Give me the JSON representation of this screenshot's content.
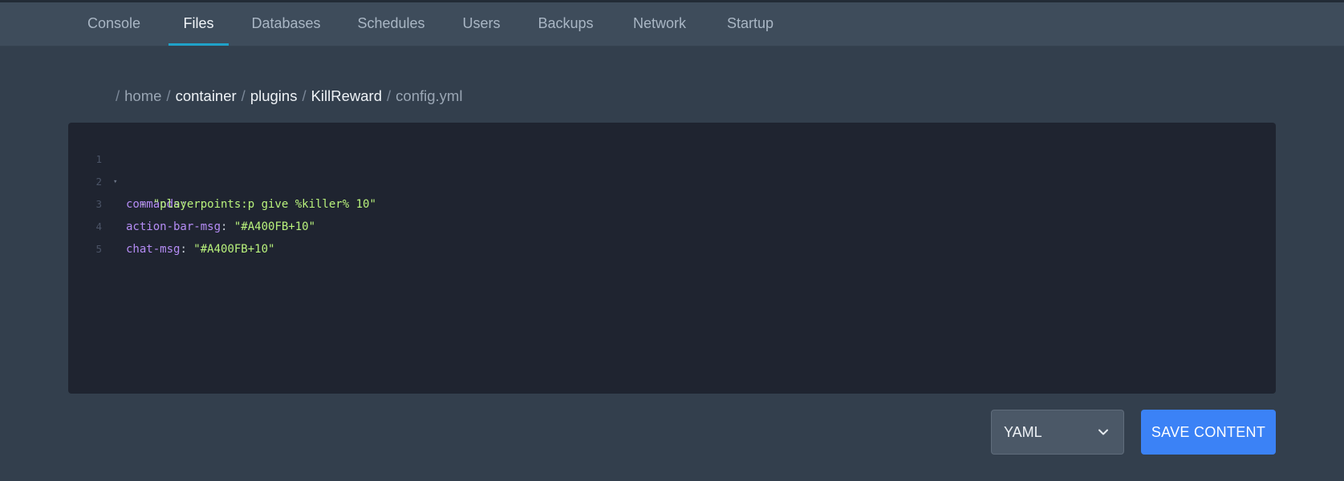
{
  "nav": {
    "tabs": [
      {
        "label": "Console"
      },
      {
        "label": "Files"
      },
      {
        "label": "Databases"
      },
      {
        "label": "Schedules"
      },
      {
        "label": "Users"
      },
      {
        "label": "Backups"
      },
      {
        "label": "Network"
      },
      {
        "label": "Startup"
      }
    ],
    "active_tab": "Files"
  },
  "breadcrumb": {
    "separator": "/",
    "items": [
      "home",
      "container",
      "plugins",
      "KillReward",
      "config.yml"
    ]
  },
  "editor": {
    "lines": [
      {
        "number": "1",
        "key": "commands",
        "colon": ":",
        "value": ""
      },
      {
        "number": "2",
        "dash": "  - ",
        "value": "\"playerpoints:p give %killer% 10\""
      },
      {
        "number": "3",
        "key": "action-bar-msg",
        "colon": ": ",
        "value": "\"#A400FB+10\""
      },
      {
        "number": "4",
        "key": "chat-msg",
        "colon": ": ",
        "value": "\"#A400FB+10\""
      },
      {
        "number": "5"
      }
    ],
    "fold_marker": "▾"
  },
  "footer": {
    "language_select": {
      "value": "YAML"
    },
    "save_label": "SAVE CONTENT"
  },
  "colors": {
    "page_bg": "#333f4d",
    "nav_bg": "#3e4c5b",
    "active_tab_underline": "#1fa2c9",
    "editor_bg": "#1f2430",
    "yaml_key": "#b58cf5",
    "yaml_string": "#b9f27c",
    "save_button": "#3b82f6"
  }
}
